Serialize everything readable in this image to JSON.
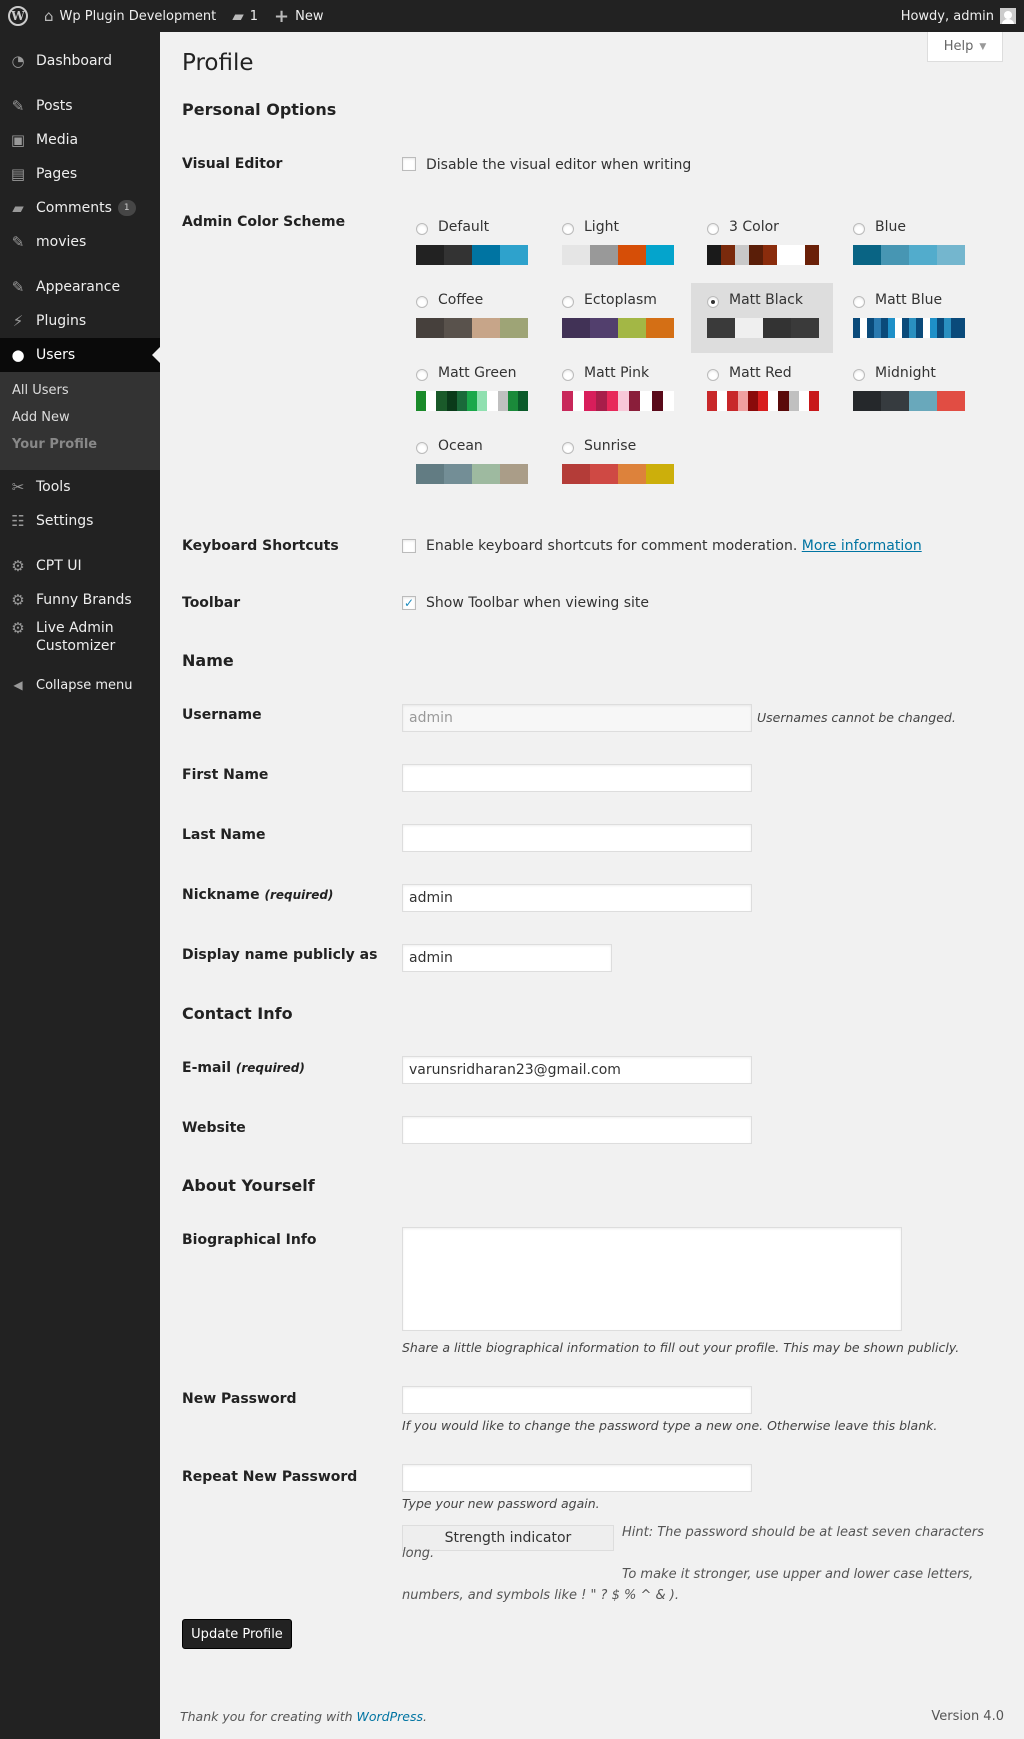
{
  "adminbar": {
    "site_name": "Wp Plugin Development",
    "comments_count": "1",
    "new_label": "New",
    "greeting": "Howdy, admin"
  },
  "sidebar": {
    "items": [
      {
        "label": "Dashboard",
        "icon": "dashboard-icon",
        "glyph": "◔"
      },
      {
        "label": "Posts",
        "icon": "pin-icon",
        "glyph": "📌"
      },
      {
        "label": "Media",
        "icon": "media-icon",
        "glyph": "▣"
      },
      {
        "label": "Pages",
        "icon": "pages-icon",
        "glyph": "▤"
      },
      {
        "label": "Comments",
        "icon": "comment-icon",
        "glyph": "▰",
        "badge": "1"
      },
      {
        "label": "movies",
        "icon": "pin-icon",
        "glyph": "📌"
      },
      {
        "label": "Appearance",
        "icon": "brush-icon",
        "glyph": "✎"
      },
      {
        "label": "Plugins",
        "icon": "plug-icon",
        "glyph": "⚡"
      },
      {
        "label": "Users",
        "icon": "user-icon",
        "glyph": "●"
      },
      {
        "label": "Tools",
        "icon": "wrench-icon",
        "glyph": "✂"
      },
      {
        "label": "Settings",
        "icon": "settings-icon",
        "glyph": "☷"
      },
      {
        "label": "CPT UI",
        "icon": "gear-icon",
        "glyph": "⚙"
      },
      {
        "label": "Funny Brands",
        "icon": "gear-icon",
        "glyph": "⚙"
      },
      {
        "label": "Live Admin",
        "label2": "Customizer",
        "icon": "gear-icon",
        "glyph": "⚙"
      },
      {
        "label": "Collapse menu",
        "icon": "collapse-icon",
        "glyph": "◀"
      }
    ],
    "submenu": [
      "All Users",
      "Add New",
      "Your Profile"
    ]
  },
  "page": {
    "title": "Profile",
    "help": "Help"
  },
  "sections": {
    "personal": "Personal Options",
    "name": "Name",
    "contact": "Contact Info",
    "about": "About Yourself"
  },
  "personal": {
    "visual_editor_label": "Visual Editor",
    "visual_editor_text": "Disable the visual editor when writing",
    "color_scheme_label": "Admin Color Scheme",
    "keyboard_label": "Keyboard Shortcuts",
    "keyboard_text": "Enable keyboard shortcuts for comment moderation.",
    "keyboard_link": "More information",
    "toolbar_label": "Toolbar",
    "toolbar_text": "Show Toolbar when viewing site"
  },
  "schemes": [
    {
      "name": "Default",
      "colors": [
        "#222222",
        "#333333",
        "#0074a2",
        "#2ea2cc"
      ]
    },
    {
      "name": "Light",
      "colors": [
        "#e5e5e5",
        "#999999",
        "#d64e07",
        "#04a4cc"
      ]
    },
    {
      "name": "3 Color",
      "colors": [
        "#1a1a1a",
        "#7a2a0c",
        "#c8c8c8",
        "#5a1e08",
        "#8a2c0c",
        "#ffffff",
        "#ffffff",
        "#6a2008"
      ]
    },
    {
      "name": "Blue",
      "colors": [
        "#096484",
        "#4796b3",
        "#52accc",
        "#74b6ce"
      ]
    },
    {
      "name": "Coffee",
      "colors": [
        "#46403c",
        "#59524c",
        "#c7a589",
        "#9ea476"
      ]
    },
    {
      "name": "Ectoplasm",
      "colors": [
        "#413256",
        "#523f6d",
        "#a3b745",
        "#d46f15"
      ]
    },
    {
      "name": "Matt Black",
      "colors": [
        "#3a3a3a",
        "#3a3a3a",
        "#efefef",
        "#efefef",
        "#333333",
        "#333333",
        "#3a3a3a",
        "#3a3a3a"
      ],
      "selected": true
    },
    {
      "name": "Matt Blue",
      "colors": [
        "#0a4a7a",
        "#ffffff",
        "#0a4a7a",
        "#2a7ab0",
        "#0a4a7a",
        "#1e90c8",
        "#ffffff",
        "#0a4a7a",
        "#2a90c0",
        "#0a4a7a",
        "#ffffff",
        "#1e90c8",
        "#0a4a7a",
        "#2a90c0",
        "#0a4a7a",
        "#0a4a7a"
      ]
    },
    {
      "name": "Matt Green",
      "colors": [
        "#1a8a2a",
        "#ffffff",
        "#1a5a2a",
        "#0a3a1a",
        "#1a6a3a",
        "#1aa84a",
        "#90e0b0",
        "#ffffff",
        "#c0c0c0",
        "#1a8a3a",
        "#0a5a2a"
      ]
    },
    {
      "name": "Matt Pink",
      "colors": [
        "#c8285a",
        "#ffffff",
        "#d81e5b",
        "#a81e4a",
        "#e8285a",
        "#f8c8d8",
        "#8a1e3a",
        "#ffffff",
        "#5a0a1a",
        "#ffffff"
      ]
    },
    {
      "name": "Matt Red",
      "colors": [
        "#c8282a",
        "#ffffff",
        "#c8282a",
        "#f0a0a0",
        "#8a0a0a",
        "#d81e1e",
        "#ffffff",
        "#5a0a0a",
        "#c0c0c0",
        "#ffffff",
        "#c8181a"
      ]
    },
    {
      "name": "Midnight",
      "colors": [
        "#25282b",
        "#363b3f",
        "#69a8bb",
        "#e14d43"
      ]
    },
    {
      "name": "Ocean",
      "colors": [
        "#627c83",
        "#738e96",
        "#9ebaa0",
        "#aa9d88"
      ]
    },
    {
      "name": "Sunrise",
      "colors": [
        "#b43c38",
        "#cf4944",
        "#dd823b",
        "#ccaf0b"
      ]
    }
  ],
  "name": {
    "username_label": "Username",
    "username_value": "admin",
    "username_note": "Usernames cannot be changed.",
    "first_name_label": "First Name",
    "last_name_label": "Last Name",
    "nickname_label": "Nickname",
    "required": "(required)",
    "nickname_value": "admin",
    "display_label": "Display name publicly as",
    "display_value": "admin"
  },
  "contact": {
    "email_label": "E-mail",
    "email_value": "varunsridharan23@gmail.com",
    "website_label": "Website"
  },
  "about": {
    "bio_label": "Biographical Info",
    "bio_desc": "Share a little biographical information to fill out your profile. This may be shown publicly.",
    "new_password_label": "New Password",
    "new_password_desc": "If you would like to change the password type a new one. Otherwise leave this blank.",
    "repeat_password_label": "Repeat New Password",
    "repeat_password_desc": "Type your new password again.",
    "strength": "Strength indicator",
    "hint_1": "Hint: The password should be at least seven characters long.",
    "hint_2": "To make it stronger, use upper and lower case letters,",
    "hint_3": "numbers, and symbols like ! \" ? $ % ^ & )."
  },
  "buttons": {
    "update": "Update Profile"
  },
  "footer": {
    "thanks": "Thank you for creating with",
    "wp_link": "WordPress",
    "version": "Version 4.0"
  }
}
